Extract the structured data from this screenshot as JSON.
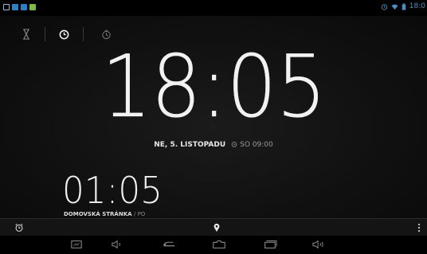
{
  "status_bar": {
    "time": "18:0",
    "notifications": [
      "notification-icon",
      "app-icon",
      "app-icon",
      "app-icon"
    ],
    "notification_colors": [
      "#8fb7d8",
      "#2f7fc4",
      "#2f7fc4",
      "#7cba4a"
    ],
    "status_icons": [
      "alarm-icon",
      "wifi-icon",
      "battery-icon"
    ]
  },
  "tabs": [
    {
      "name": "timer",
      "icon": "hourglass-icon",
      "selected": false
    },
    {
      "name": "clock",
      "icon": "clock-icon",
      "selected": true
    },
    {
      "name": "stopwatch",
      "icon": "stopwatch-icon",
      "selected": false
    }
  ],
  "clock": {
    "time": "18:05",
    "date": "NE, 5. LISTOPADU",
    "next_alarm": "SO 09:00"
  },
  "world_clock": {
    "time": "01:05",
    "city": "DOMOVSKÁ STRÁNKA",
    "day": "/ PO"
  },
  "action_bar": {
    "left_icon": "alarm-icon",
    "center_icon": "location-pin-icon",
    "right_icon": "overflow-menu-icon"
  },
  "nav_bar": [
    "screenshot-icon",
    "volume-down-icon",
    "back-icon",
    "home-icon",
    "recent-apps-icon",
    "volume-up-icon"
  ],
  "colors": {
    "background": "#000000",
    "text": "#f2f2f2",
    "accent": "#4a8fc2"
  }
}
